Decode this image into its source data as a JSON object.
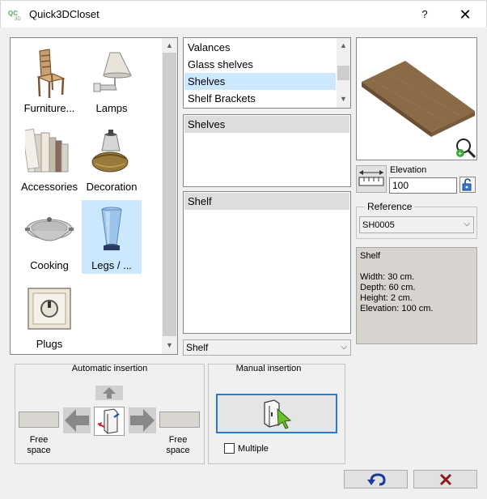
{
  "window": {
    "title": "Quick3DCloset",
    "help_label": "?",
    "close_label": "✕"
  },
  "catalog": {
    "items": [
      {
        "label": "Furniture...",
        "icon": "chair-icon"
      },
      {
        "label": "Lamps",
        "icon": "lamp-icon"
      },
      {
        "label": "Accessories",
        "icon": "books-icon"
      },
      {
        "label": "Decoration",
        "icon": "basket-icon"
      },
      {
        "label": "Cooking",
        "icon": "wok-icon"
      },
      {
        "label": "Legs / ...",
        "icon": "leg-icon",
        "selected": true
      },
      {
        "label": "Plugs",
        "icon": "plug-icon"
      }
    ]
  },
  "subcategories": {
    "items": [
      {
        "label": "Valances"
      },
      {
        "label": "Glass shelves"
      },
      {
        "label": "Shelves",
        "selected": true
      },
      {
        "label": "Shelf Brackets"
      }
    ]
  },
  "group_list": {
    "header": "Shelves"
  },
  "model_list": {
    "header": "Shelf"
  },
  "model_combo": {
    "value": "Shelf"
  },
  "elevation": {
    "label": "Elevation",
    "value": "100"
  },
  "reference": {
    "legend": "Reference",
    "value": "SH0005"
  },
  "info": {
    "name": "Shelf",
    "width": "Width: 30 cm.",
    "depth": "Depth: 60 cm.",
    "height": "Height: 2 cm.",
    "elevation": "Elevation: 100 cm."
  },
  "automatic": {
    "title": "Automatic insertion",
    "left_label_1": "Free",
    "left_label_2": "space",
    "right_label_1": "Free",
    "right_label_2": "space"
  },
  "manual": {
    "title": "Manual insertion",
    "multiple_label": "Multiple",
    "multiple_checked": false
  }
}
